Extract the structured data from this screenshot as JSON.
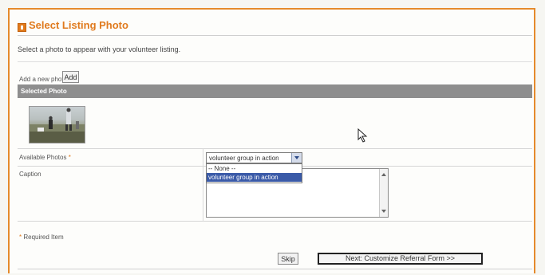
{
  "header": {
    "title": "Select Listing Photo",
    "icon": "orange-square-icon",
    "accent_color": "#e07a1e"
  },
  "intro_text": "Select a photo to appear with your volunteer listing.",
  "add_photo": {
    "label": "Add a new photo:",
    "button_label": "Add"
  },
  "selected_photo": {
    "header_label": "Selected Photo",
    "thumbnail_icon": "photo-thumbnail"
  },
  "form": {
    "available_photos_label": "Available Photos",
    "required_marker": "*",
    "select_value": "volunteer group in action",
    "options": [
      "-- None --",
      "volunteer group in action"
    ],
    "caption_label": "Caption",
    "caption_value": ""
  },
  "required_note": "* Required Item",
  "buttons": {
    "skip": "Skip",
    "next": "Next: Customize Referral Form >>"
  }
}
